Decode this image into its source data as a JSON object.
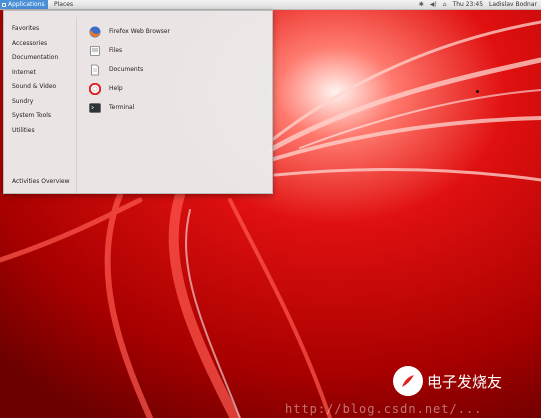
{
  "top_panel": {
    "applications_label": "Applications",
    "places_label": "Places",
    "clock": "Thu 23:45",
    "user": "Ladislav Bodnar"
  },
  "menu": {
    "categories": [
      {
        "label": "Favorites"
      },
      {
        "label": "Accessories"
      },
      {
        "label": "Documentation"
      },
      {
        "label": "Internet"
      },
      {
        "label": "Sound & Video"
      },
      {
        "label": "Sundry"
      },
      {
        "label": "System Tools"
      },
      {
        "label": "Utilities"
      }
    ],
    "activities_label": "Activities Overview",
    "apps": [
      {
        "label": "Firefox Web Browser",
        "icon": "firefox-icon"
      },
      {
        "label": "Files",
        "icon": "files-icon"
      },
      {
        "label": "Documents",
        "icon": "documents-icon"
      },
      {
        "label": "Help",
        "icon": "help-icon"
      },
      {
        "label": "Terminal",
        "icon": "terminal-icon"
      }
    ]
  },
  "watermark": {
    "brand": "电子发烧友",
    "url": "http://blog.csdn.net/..."
  },
  "colors": {
    "wallpaper_red": "#b00000",
    "panel_bg": "#e6e6e6",
    "applications_highlight": "#4a90d9"
  }
}
